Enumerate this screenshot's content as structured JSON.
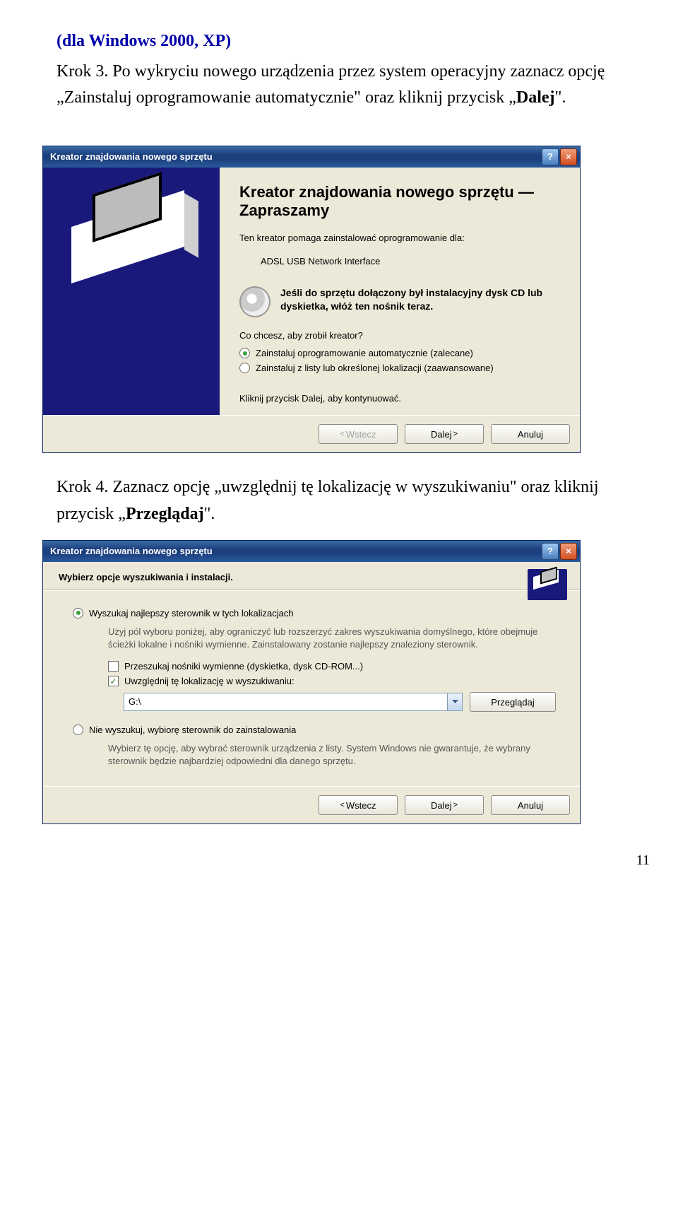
{
  "doc": {
    "header_small": "(dla Windows 2000, XP)",
    "step3_label": "Krok 3.",
    "step3_text": " Po wykryciu nowego urządzenia przez system operacyjny zaznacz opcję „Zainstaluj oprogramowanie automatycznie\" oraz kliknij przycisk „",
    "step3_bold": "Dalej",
    "step3_after": "\".",
    "step4_label": "Krok 4.",
    "step4_text": " Zaznacz opcję „uwzględnij tę lokalizację w wyszukiwaniu\" oraz kliknij przycisk „",
    "step4_bold": "Przeglądaj",
    "step4_after": "\".",
    "page_num": "11"
  },
  "dlg1": {
    "title": "Kreator znajdowania nowego sprzętu",
    "heading": "Kreator znajdowania nowego sprzętu — Zapraszamy",
    "intro": "Ten kreator pomaga zainstalować oprogramowanie dla:",
    "device": "ADSL USB Network Interface",
    "cd_text": "Jeśli do sprzętu dołączony był instalacyjny dysk CD lub dyskietka, włóż ten nośnik teraz.",
    "question": "Co chcesz, aby zrobił kreator?",
    "opt_auto": "Zainstaluj oprogramowanie automatycznie (zalecane)",
    "opt_list": "Zainstaluj z listy lub określonej lokalizacji (zaawansowane)",
    "continue": "Kliknij przycisk Dalej, aby kontynuować.",
    "back": "Wstecz",
    "next": "Dalej",
    "cancel": "Anuluj"
  },
  "dlg2": {
    "title": "Kreator znajdowania nowego sprzętu",
    "header": "Wybierz opcje wyszukiwania i instalacji.",
    "opt_search": "Wyszukaj najlepszy sterownik w tych lokalizacjach",
    "search_help": "Użyj pól wyboru poniżej, aby ograniczyć lub rozszerzyć zakres wyszukiwania domyślnego, które obejmuje ścieżki lokalne i nośniki wymienne. Zainstalowany zostanie najlepszy znaleziony sterownik.",
    "chk_removable": "Przeszukaj nośniki wymienne (dyskietka, dysk CD-ROM...)",
    "chk_include": "Uwzględnij tę lokalizację w wyszukiwaniu:",
    "path": "G:\\",
    "browse": "Przeglądaj",
    "opt_nosrch": "Nie wyszukuj, wybiorę sterownik do zainstalowania",
    "nosrch_help": "Wybierz tę opcję, aby wybrać sterownik urządzenia z listy. System Windows nie gwarantuje, że wybrany sterownik będzie najbardziej odpowiedni dla danego sprzętu.",
    "back": "Wstecz",
    "next": "Dalej",
    "cancel": "Anuluj"
  }
}
